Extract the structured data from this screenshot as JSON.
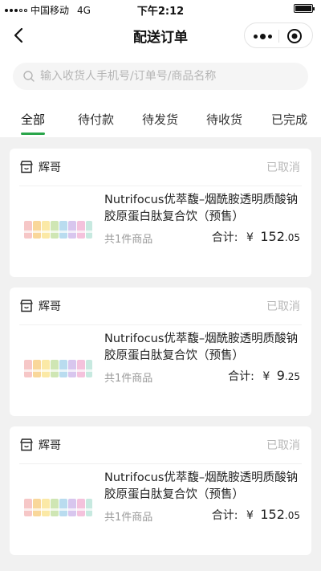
{
  "status_bar": {
    "carrier": "中国移动",
    "network": "4G",
    "time": "下午2:12"
  },
  "nav": {
    "title": "配送订单"
  },
  "search": {
    "placeholder": "输入收货人手机号/订单号/商品名称",
    "value": ""
  },
  "tabs": [
    {
      "label": "全部",
      "active": true
    },
    {
      "label": "待付款",
      "active": false
    },
    {
      "label": "待发货",
      "active": false
    },
    {
      "label": "待收货",
      "active": false
    },
    {
      "label": "已完成",
      "active": false
    }
  ],
  "colors": {
    "accent": "#2aa54a",
    "background": "#f1f1f1",
    "status_text": "#b8b8b8"
  },
  "orders": [
    {
      "shop_name": "辉哥",
      "status": "已取消",
      "product_name": "Nutrifocus优萃馥–烟酰胺透明质酸钠胶原蛋白肽复合饮（预售）",
      "item_count": "共1件商品",
      "total_label": "合计:",
      "currency": "¥",
      "total_integer": "152",
      "total_decimal": ".05"
    },
    {
      "shop_name": "辉哥",
      "status": "已取消",
      "product_name": "Nutrifocus优萃馥–烟酰胺透明质酸钠胶原蛋白肽复合饮（预售）",
      "item_count": "共1件商品",
      "total_label": "合计:",
      "currency": "¥",
      "total_integer": "9",
      "total_decimal": ".25"
    },
    {
      "shop_name": "辉哥",
      "status": "已取消",
      "product_name": "Nutrifocus优萃馥–烟酰胺透明质酸钠胶原蛋白肽复合饮（预售）",
      "item_count": "共1件商品",
      "total_label": "合计:",
      "currency": "¥",
      "total_integer": "152",
      "total_decimal": ".05"
    }
  ]
}
